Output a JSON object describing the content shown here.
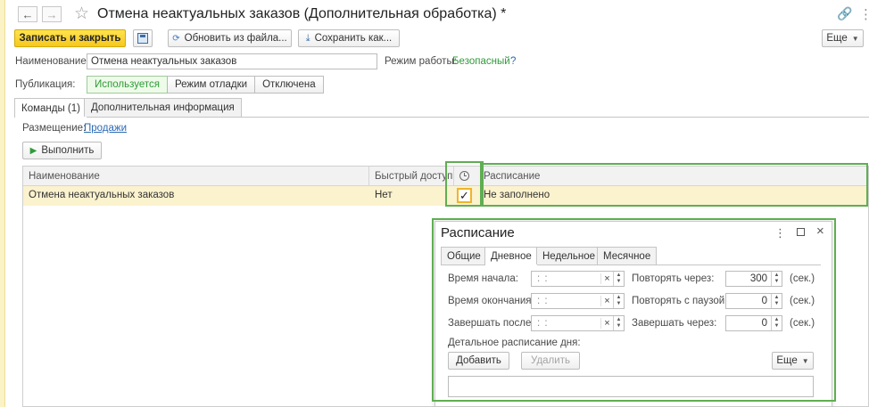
{
  "window": {
    "title": "Отмена неактуальных заказов (Дополнительная обработка) *",
    "back_icon": "arrow-left-icon",
    "forward_icon": "arrow-right-icon",
    "favorite_icon": "star-icon"
  },
  "toolbar": {
    "save_close_label": "Записать и закрыть",
    "update_from_file_label": "Обновить из файла...",
    "save_as_label": "Сохранить как...",
    "more_label": "Еще"
  },
  "form": {
    "name_label": "Наименование:",
    "name_value": "Отмена неактуальных заказов",
    "mode_label": "Режим работы:",
    "mode_value": "Безопасный",
    "mode_help": "?",
    "publication_label": "Публикация:",
    "publication_options": [
      "Используется",
      "Режим отладки",
      "Отключена"
    ],
    "publication_selected": "Используется"
  },
  "tabs": {
    "commands": "Команды (1)",
    "additional": "Дополнительная информация"
  },
  "commands": {
    "placement_label": "Размещение:",
    "placement_value": "Продажи",
    "run_label": "Выполнить",
    "columns": {
      "name": "Наименование",
      "quick_access": "Быстрый доступ",
      "schedule": "Расписание"
    },
    "rows": [
      {
        "name": "Отмена неактуальных заказов",
        "quick_access": "Нет",
        "schedule_enabled": true,
        "schedule": "Не заполнено"
      }
    ]
  },
  "schedule_dialog": {
    "title": "Расписание",
    "tabs": [
      "Общие",
      "Дневное",
      "Недельное",
      "Месячное"
    ],
    "active_tab": "Дневное",
    "start_time_label": "Время начала:",
    "end_time_label": "Время окончания:",
    "finish_after_label": "Завершать после:",
    "time_placeholder": ":  :",
    "repeat_every_label": "Повторять через:",
    "repeat_every_value": "300",
    "repeat_pause_label": "Повторять с паузой:",
    "repeat_pause_value": "0",
    "finish_in_label": "Завершать через:",
    "finish_in_value": "0",
    "unit_label": "(сек.)",
    "detail_label": "Детальное расписание дня:",
    "add_label": "Добавить",
    "delete_label": "Удалить",
    "more_label": "Еще"
  },
  "colors": {
    "accent_yellow": "#f6c81d",
    "highlight_green": "#5fae52",
    "link_blue": "#2c6ab5",
    "selected_row": "#fbf2ce"
  }
}
